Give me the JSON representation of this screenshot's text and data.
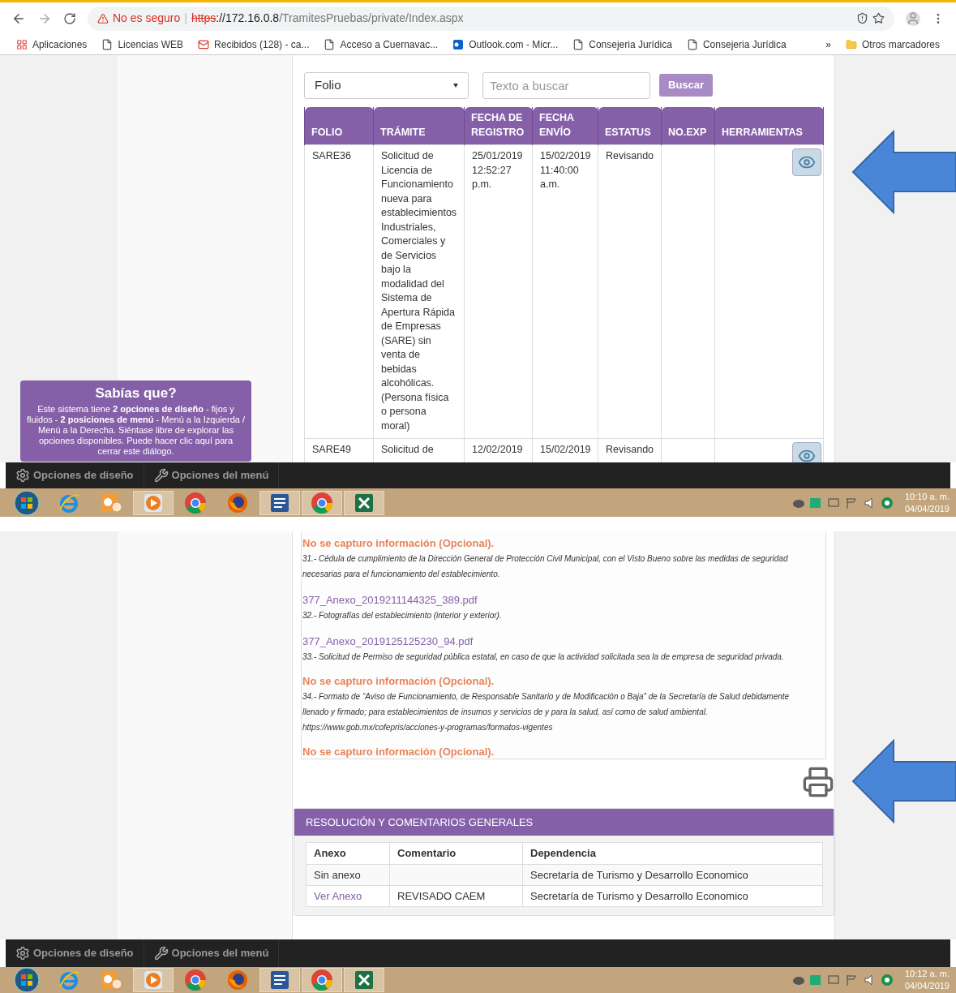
{
  "top_capture": {
    "browser": {
      "security_label": "No es seguro",
      "separator": "|",
      "url_scheme": "https",
      "url_host": "://172.16.0.8",
      "url_path": "/TramitesPruebas/private/Index.aspx",
      "bookmarks": [
        {
          "label": "Aplicaciones",
          "kind": "apps"
        },
        {
          "label": "Licencias WEB",
          "kind": "page"
        },
        {
          "label": "Recibidos (128) - ca...",
          "kind": "mail"
        },
        {
          "label": "Acceso a Cuernavac...",
          "kind": "page"
        },
        {
          "label": "Outlook.com - Micr...",
          "kind": "outlook"
        },
        {
          "label": "Consejeria Jurídica",
          "kind": "page"
        },
        {
          "label": "Consejeria Jurídica",
          "kind": "page"
        }
      ],
      "overflow": "»",
      "other_bookmarks": "Otros marcadores"
    },
    "search": {
      "field": "Folio",
      "placeholder": "Texto a buscar",
      "button": "Buscar"
    },
    "table": {
      "columns": [
        {
          "line2": "FOLIO"
        },
        {
          "line2": "TRÁMITE"
        },
        {
          "line1": "FECHA DE",
          "line2": "REGISTRO"
        },
        {
          "line1": "FECHA",
          "line2": "ENVÍO"
        },
        {
          "line2": "ESTATUS"
        },
        {
          "line2": "NO.EXP"
        },
        {
          "line2": "HERRAMIENTAS"
        }
      ],
      "rows": [
        {
          "cells": [
            "SARE36",
            "Solicitud de Licencia de Funcionamiento nueva para establecimientos Industriales, Comerciales y de Servicios bajo la modalidad del Sistema de Apertura Rápida de Empresas (SARE) sin venta de bebidas alcohólicas. (Persona física o persona moral)",
            "25/01/2019 12:52:27 p.m.",
            "15/02/2019 11:40:00 a.m.",
            "Revisando"
          ]
        },
        {
          "cells": [
            "SARE49",
            "Solicitud de",
            "12/02/2019",
            "15/02/2019",
            "Revisando"
          ]
        }
      ]
    },
    "tip": {
      "title": "Sabías que?",
      "text": "Este sistema tiene **2 opciones de diseño** - fijos y fluidos - **2 posiciones de menú** - Menú a la Izquierda / Menú a la Derecha. Siéntase libre de explorar las opciones disponibles. Puede hacer clic aquí para cerrar este diálogo."
    },
    "bottom_bar": [
      {
        "label": "Opciones de diseño",
        "kind": "gear"
      },
      {
        "label": "Opciones del menú",
        "kind": "tools"
      }
    ],
    "taskbar": {
      "apps": [
        {
          "kind": "start",
          "open": false
        },
        {
          "kind": "ie",
          "open": false
        },
        {
          "kind": "outlook",
          "open": false
        },
        {
          "kind": "media",
          "open": true
        },
        {
          "kind": "chrome",
          "open": false
        },
        {
          "kind": "firefox",
          "open": false
        },
        {
          "kind": "word",
          "open": true
        },
        {
          "kind": "chrome",
          "open": true
        },
        {
          "kind": "excel",
          "open": true
        }
      ],
      "time": "10:10 a. m.",
      "date": "04/04/2019"
    }
  },
  "bottom_capture": {
    "items": [
      {
        "kind": "missing",
        "text": "No se capturo información (Opcional)."
      },
      {
        "kind": "note",
        "text": "31.- Cédula de cumplimiento de la Dirección General de Protección Civil Municipal, con el Visto Bueno sobre las medidas de seguridad necesarias para el funcionamiento del establecimiento."
      },
      {
        "kind": "file",
        "text": "377_Anexo_2019211144325_389.pdf"
      },
      {
        "kind": "note",
        "text": "32.- Fotografías del establecimiento (interior y exterior)."
      },
      {
        "kind": "file",
        "text": "377_Anexo_2019125125230_94.pdf"
      },
      {
        "kind": "note",
        "text": "33.- Solicitud de Permiso de seguridad pública estatal, en caso de que la actividad solicitada sea la de empresa de seguridad privada."
      },
      {
        "kind": "missing",
        "text": "No se capturo información (Opcional)."
      },
      {
        "kind": "note",
        "text": "34.- Formato de “Aviso de Funcionamiento, de Responsable Sanitario y de Modificación o Baja” de la Secretaría de Salud debidamente llenado y firmado; para establecimientos de insumos y servicios de y para la salud, así como de salud ambiental. https://www.gob.mx/cofepris/acciones-y-programas/formatos-vigentes"
      },
      {
        "kind": "missing",
        "text": "No se capturo información (Opcional)."
      }
    ],
    "resolution": {
      "title": "RESOLUCIÓN Y COMENTARIOS GENERALES",
      "columns": [
        "Anexo",
        "Comentario",
        "Dependencia"
      ],
      "rows": [
        {
          "anexo": "Sin anexo",
          "anexo_link": false,
          "dependencia": "Secretaría de Turismo y Desarrollo Economico"
        },
        {
          "anexo": "Ver Anexo",
          "anexo_link": true,
          "comentario": "REVISADO CAEM",
          "dependencia": "Secretaría de Turismo y Desarrollo Economico"
        }
      ]
    },
    "bottom_bar": [
      {
        "label": "Opciones de diseño",
        "kind": "gear"
      },
      {
        "label": "Opciones del menú",
        "kind": "tools"
      }
    ],
    "taskbar": {
      "apps": [
        {
          "kind": "start",
          "open": false
        },
        {
          "kind": "ie",
          "open": false
        },
        {
          "kind": "outlook",
          "open": false
        },
        {
          "kind": "media",
          "open": true
        },
        {
          "kind": "chrome",
          "open": false
        },
        {
          "kind": "firefox",
          "open": false
        },
        {
          "kind": "word",
          "open": true
        },
        {
          "kind": "chrome",
          "open": true
        },
        {
          "kind": "excel",
          "open": true
        }
      ],
      "time": "10:12 a. m.",
      "date": "04/04/2019"
    }
  }
}
